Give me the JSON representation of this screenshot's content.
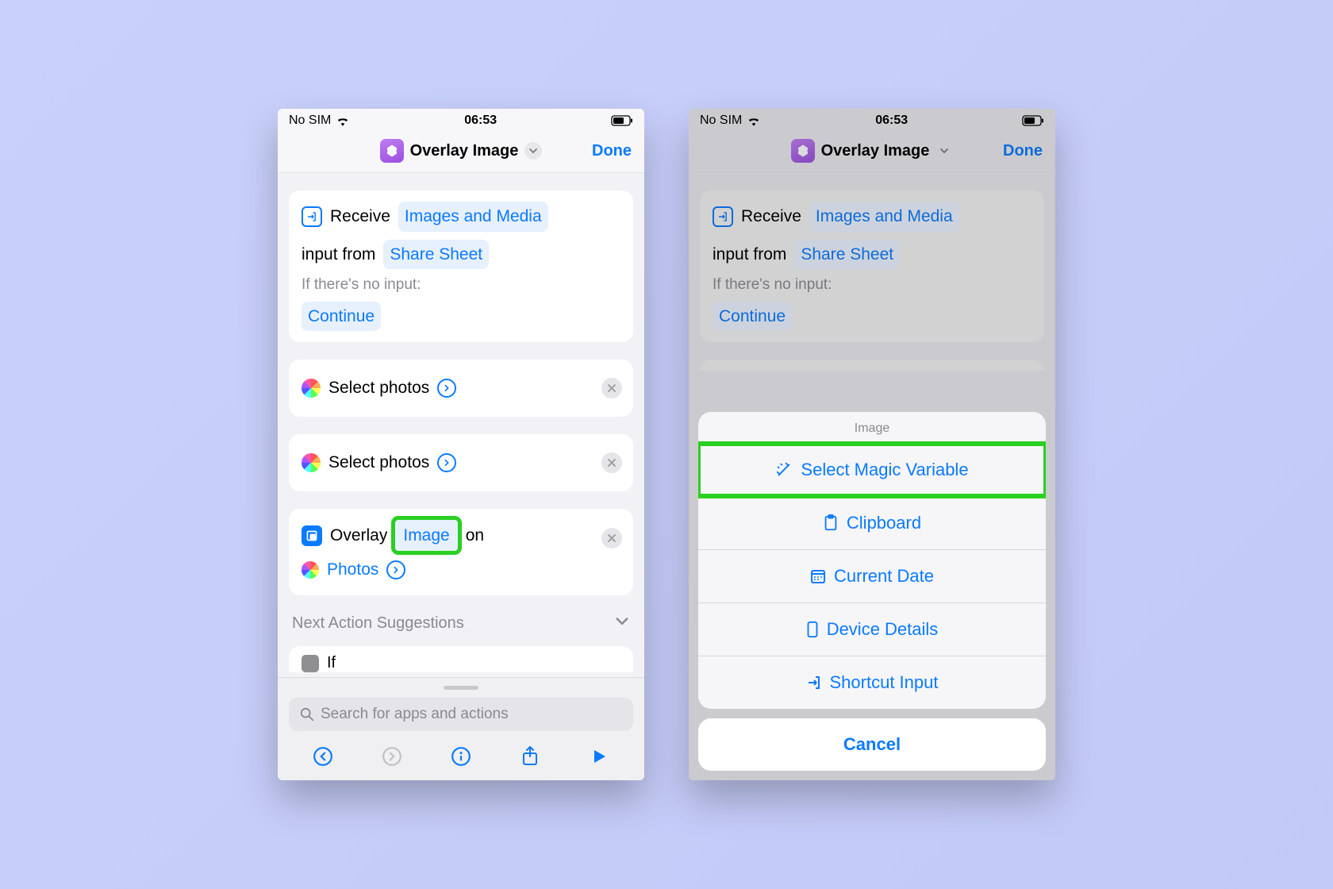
{
  "status": {
    "carrier": "No SIM",
    "time": "06:53"
  },
  "nav": {
    "title": "Overlay Image",
    "done": "Done"
  },
  "receive": {
    "word_receive": "Receive",
    "types": "Images and Media",
    "word_input_from": "input from",
    "source": "Share Sheet",
    "no_input_label": "If there's no input:",
    "fallback": "Continue"
  },
  "actions": {
    "select_photos": "Select photos",
    "overlay_word": "Overlay",
    "image_token": "Image",
    "on_word": "on",
    "photos_token": "Photos"
  },
  "suggestions": {
    "label": "Next Action Suggestions",
    "peek": "If"
  },
  "search": {
    "placeholder": "Search for apps and actions"
  },
  "sheet": {
    "title": "Image",
    "items": {
      "magic": "Select Magic Variable",
      "clipboard": "Clipboard",
      "date": "Current Date",
      "device": "Device Details",
      "input": "Shortcut Input"
    },
    "cancel": "Cancel"
  }
}
